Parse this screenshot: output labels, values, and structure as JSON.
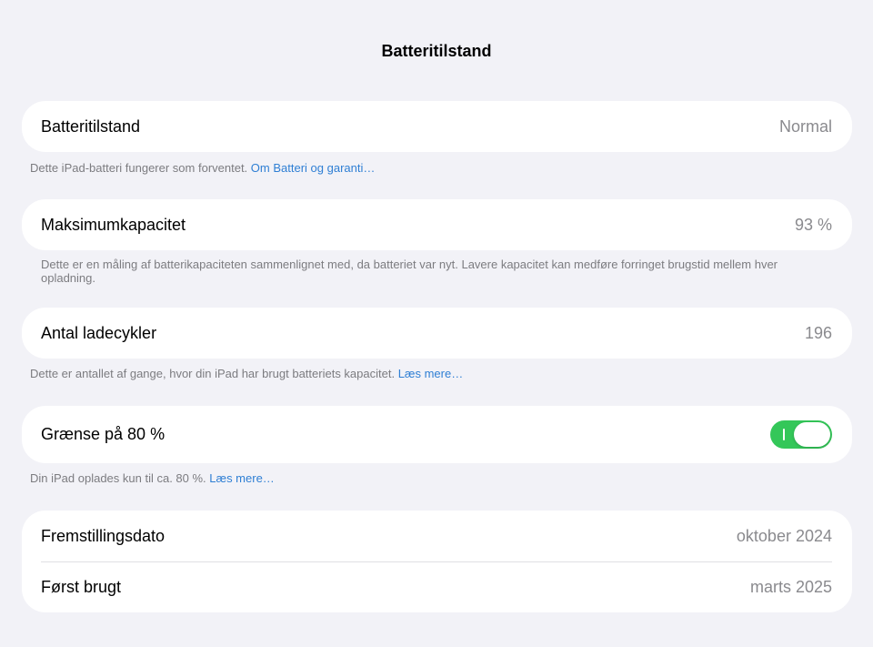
{
  "header": {
    "title": "Batteritilstand"
  },
  "battery_health": {
    "label": "Batteritilstand",
    "value": "Normal",
    "footer_text": "Dette iPad-batteri fungerer som forventet. ",
    "footer_link": "Om Batteri og garanti…"
  },
  "max_capacity": {
    "label": "Maksimumkapacitet",
    "value": "93 %",
    "footer_text": "Dette er en måling af batterikapaciteten sammenlignet med, da batteriet var nyt. Lavere kapacitet kan medføre forringet brugstid mellem hver opladning."
  },
  "cycle_count": {
    "label": "Antal ladecykler",
    "value": "196",
    "footer_text": "Dette er antallet af gange, hvor din iPad har brugt batteriets kapacitet. ",
    "footer_link": "Læs mere…"
  },
  "limit_80": {
    "label": "Grænse på 80 %",
    "enabled": true,
    "footer_text": "Din iPad oplades kun til ca. 80 %. ",
    "footer_link": "Læs mere…"
  },
  "dates": {
    "manufacture_label": "Fremstillingsdato",
    "manufacture_value": "oktober 2024",
    "first_use_label": "Først brugt",
    "first_use_value": "marts 2025"
  },
  "colors": {
    "background": "#f2f2f7",
    "toggle_on": "#34c759",
    "link": "#2f7fd4"
  }
}
